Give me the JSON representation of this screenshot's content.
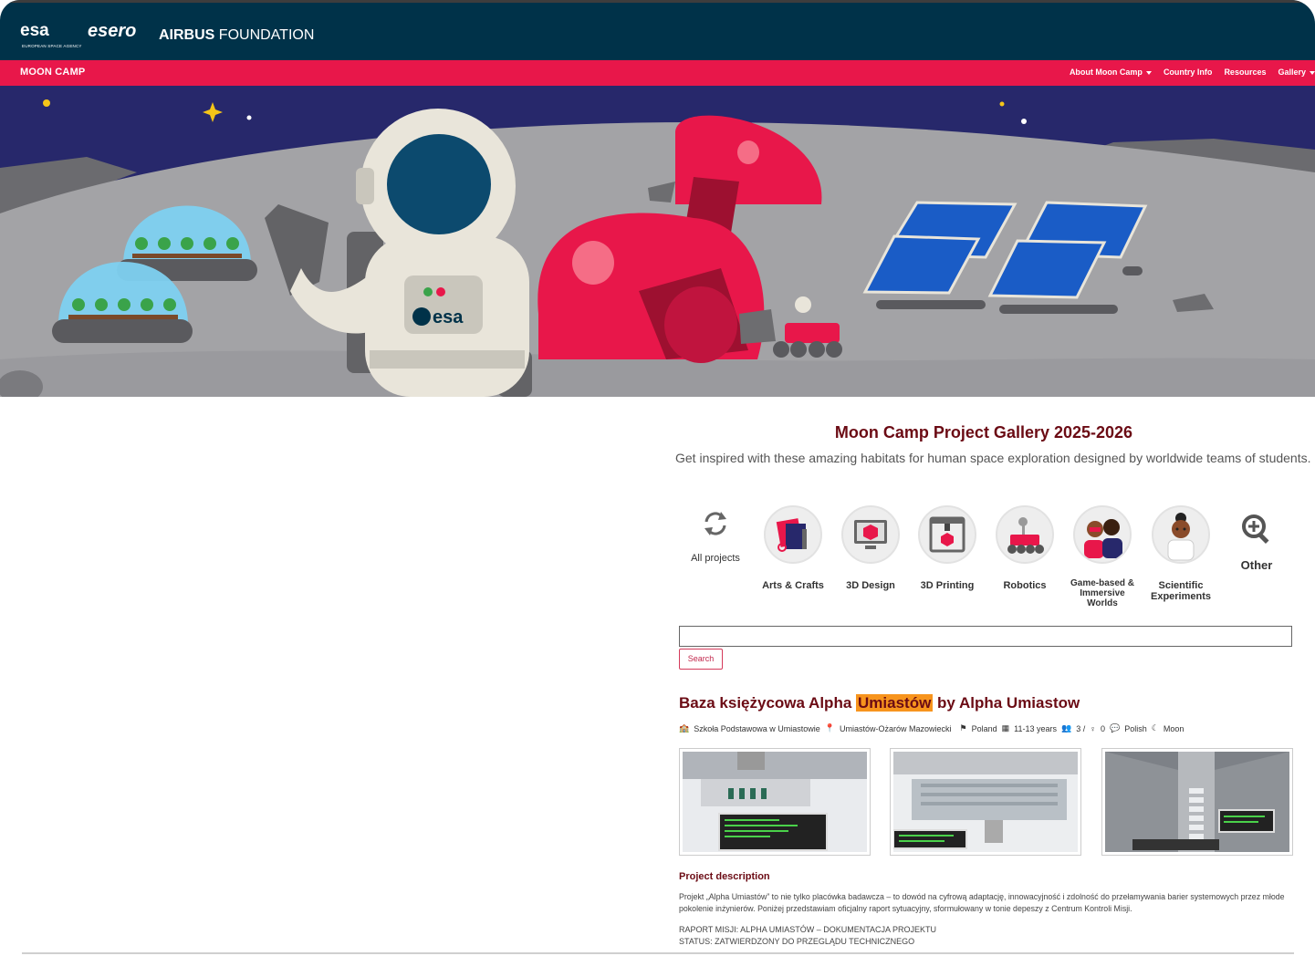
{
  "header": {
    "esa_logo": "esa",
    "esa_subtitle": "EUROPEAN SPACE AGENCY",
    "esero_logo": "esero",
    "airbus_bold": "AIRBUS",
    "airbus_light": "FOUNDATION"
  },
  "nav": {
    "brand": "MOON CAMP",
    "links": [
      {
        "label": "About Moon Camp",
        "dropdown": true
      },
      {
        "label": "Country Info",
        "dropdown": false
      },
      {
        "label": "Resources",
        "dropdown": false
      },
      {
        "label": "Gallery",
        "dropdown": true
      }
    ]
  },
  "hero": {
    "badge_text": "esa"
  },
  "gallery": {
    "title": "Moon Camp Project Gallery 2025-2026",
    "subtitle": "Get inspired with these amazing habitats for human space exploration designed by worldwide teams of students.",
    "categories": [
      {
        "label": "All projects",
        "icon": "refresh-icon"
      },
      {
        "label": "Arts & Crafts",
        "icon": "arts-crafts-icon"
      },
      {
        "label": "3D Design",
        "icon": "3d-design-icon"
      },
      {
        "label": "3D Printing",
        "icon": "3d-printing-icon"
      },
      {
        "label": "Robotics",
        "icon": "robotics-icon"
      },
      {
        "label": "Game-based & Immersive Worlds",
        "icon": "game-based-icon"
      },
      {
        "label": "Scientific Experiments",
        "icon": "scientific-icon"
      },
      {
        "label": "Other",
        "icon": "magnifier-plus-icon"
      }
    ],
    "search": {
      "value": "",
      "button": "Search"
    }
  },
  "project": {
    "title_before": "Baza księżycowa Alpha ",
    "title_highlight": "Umiastów",
    "title_after": " by Alpha Umiastow",
    "school": "Szkoła Podstawowa w Umiastowie",
    "location": "Umiastów-Ożarów Mazowiecki",
    "country": "Poland",
    "age": "11-13 years",
    "team": "3 /",
    "female": "0",
    "language": "Polish",
    "destination": "Moon",
    "description_heading": "Project description",
    "description": "Projekt „Alpha Umiastów” to nie tylko placówka badawcza – to dowód na cyfrową adaptację, innowacyjność i zdolność do przełamywania barier systemowych przez młode pokolenie inżynierów. Poniżej przedstawiam oficjalny raport sytuacyjny, sformułowany w tonie depeszy z Centrum Kontroli Misji.",
    "report_line1": "RAPORT MISJI: ALPHA UMIASTÓW – DOKUMENTACJA PROJEKTU",
    "report_line2": "STATUS: ZATWIERDZONY DO PRZEGLĄDU TECHNICZNEGO"
  }
}
